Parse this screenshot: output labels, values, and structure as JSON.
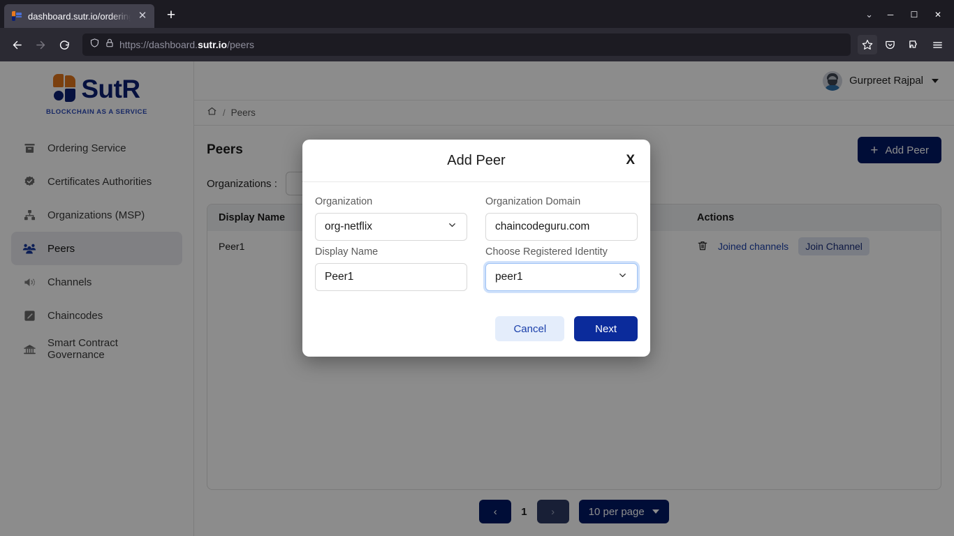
{
  "browser": {
    "tab": {
      "title": "dashboard.sutr.io/ordering",
      "close_label": "✕"
    },
    "newtab_label": "+",
    "tabstrip_chevron": "⌄",
    "window_minimize": "─",
    "window_maximize": "☐",
    "window_close": "✕",
    "url_prefix": "https://dashboard.",
    "url_domain": "sutr.io",
    "url_path": "/peers",
    "icons": {
      "back": "back-arrow-icon",
      "forward": "forward-arrow-icon",
      "reload": "reload-icon",
      "shield": "shield-icon",
      "lock": "lock-icon",
      "bookmark": "star-icon",
      "pocket": "pocket-icon",
      "extensions": "extensions-icon",
      "menu": "hamburger-menu-icon"
    }
  },
  "sidebar": {
    "logo_text": "SutR",
    "logo_tagline": "BLOCKCHAIN AS A SERVICE",
    "items": [
      {
        "label": "Ordering Service",
        "icon": "archive-box-icon",
        "active": false
      },
      {
        "label": "Certificates Authorities",
        "icon": "certificate-badge-icon",
        "active": false
      },
      {
        "label": "Organizations (MSP)",
        "icon": "org-hierarchy-icon",
        "active": false
      },
      {
        "label": "Peers",
        "icon": "peers-group-icon",
        "active": true
      },
      {
        "label": "Channels",
        "icon": "megaphone-icon",
        "active": false
      },
      {
        "label": "Chaincodes",
        "icon": "code-note-icon",
        "active": false
      },
      {
        "label": "Smart Contract Governance",
        "icon": "bank-icon",
        "active": false
      }
    ]
  },
  "topbar": {
    "user_name": "Gurpreet Rajpal",
    "avatar": "user-avatar",
    "caret": "chevron-down-icon"
  },
  "breadcrumb": {
    "home_icon": "home-icon",
    "separator": "/",
    "current": "Peers"
  },
  "page": {
    "title": "Peers",
    "add_button_label": "Add Peer",
    "add_button_plus": "+",
    "filter_label": "Organizations :",
    "filter_value": ""
  },
  "table": {
    "columns": [
      "Display Name",
      "",
      "",
      "Actions"
    ],
    "rows": [
      {
        "display_name": "Peer1",
        "col2": "",
        "col3": "",
        "delete_icon": "trash-icon",
        "joined_channels_label": "Joined channels",
        "join_channel_label": "Join Channel"
      }
    ]
  },
  "pagination": {
    "prev_label": "‹",
    "page_number": "1",
    "next_label": "›",
    "page_size_label": "10 per page",
    "page_size_caret": "chevron-down-icon"
  },
  "modal": {
    "title": "Add Peer",
    "close_label": "X",
    "fields": [
      {
        "label": "Organization",
        "value": "org-netflix",
        "type": "select",
        "focused": false
      },
      {
        "label": "Organization Domain",
        "value": "chaincodeguru.com",
        "type": "text",
        "focused": false
      },
      {
        "label": "Display Name",
        "value": "Peer1",
        "type": "text",
        "focused": false
      },
      {
        "label": "Choose Registered Identity",
        "value": "peer1",
        "type": "select",
        "focused": true
      }
    ],
    "cancel_label": "Cancel",
    "next_label": "Next"
  },
  "colors": {
    "brand_navy": "#0c2074",
    "brand_orange": "#e0751c",
    "primary_button": "#001965",
    "next_button": "#0b2b9b",
    "cancel_button_bg": "#e4edfb",
    "link": "#1a3faa",
    "browser_chrome": "#2b2a33",
    "overlay": "rgba(0,0,0,0.45)"
  }
}
